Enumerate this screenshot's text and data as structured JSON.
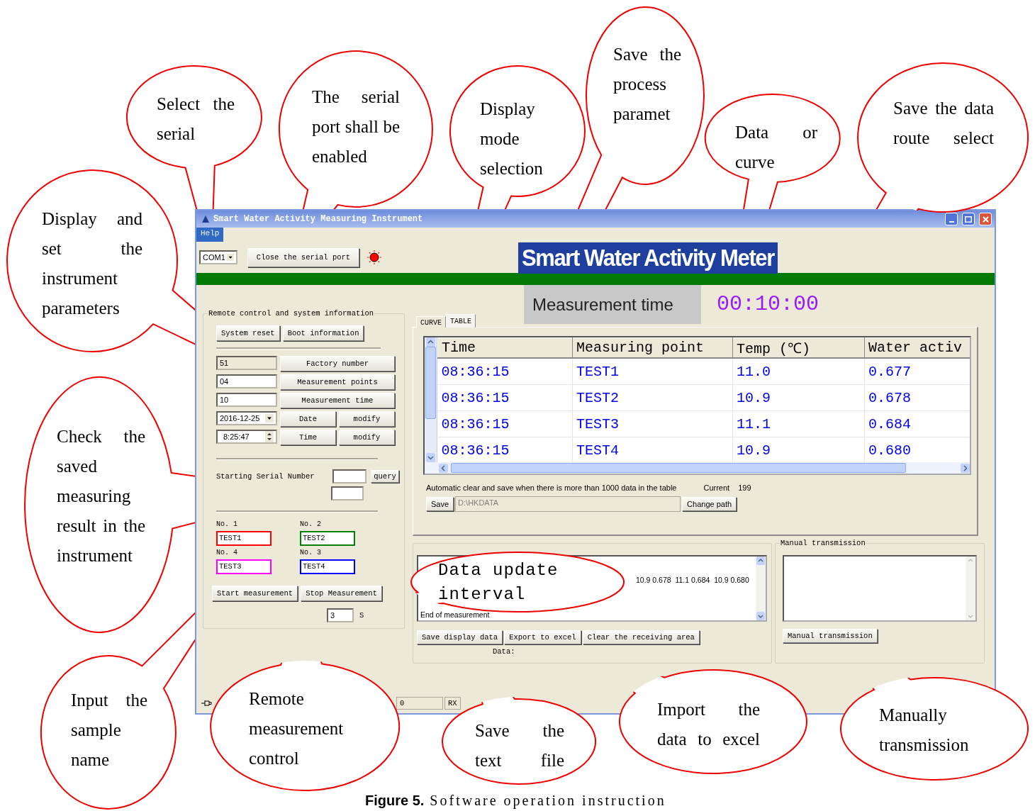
{
  "window": {
    "title": "Smart Water Activity Measuring Instrument",
    "menu": [
      {
        "label": "Help",
        "selected": true
      }
    ]
  },
  "toolbar": {
    "port": "COM1",
    "port_button": "Close the serial port",
    "port_open": true
  },
  "banner": {
    "title": "Smart Water Activity Meter",
    "time_label": "Measurement time",
    "time": "00:10:00"
  },
  "remote_panel": {
    "title": "Remote control and system information",
    "buttons": [
      "System reset",
      "Boot information"
    ],
    "params": [
      {
        "kind": "readonly",
        "value": "51",
        "button": "Factory number"
      },
      {
        "kind": "field",
        "value": "04",
        "button": "Measurement points"
      },
      {
        "kind": "field",
        "value": "10",
        "button": "Measurement time"
      },
      {
        "kind": "date",
        "value": "2016-12-25",
        "button": "Date",
        "action": "modify"
      },
      {
        "kind": "time",
        "value": "8:25:47",
        "button": "Time",
        "action": "modify"
      }
    ],
    "serial_label": "Starting Serial Number",
    "query_button": "query",
    "samples": [
      {
        "label": "No. 1",
        "name": "TEST1",
        "color": "#ff0000"
      },
      {
        "label": "No. 2",
        "name": "TEST2",
        "color": "#008000"
      },
      {
        "label": "No. 4",
        "name": "TEST3",
        "color": "#ff00ff"
      },
      {
        "label": "No. 3",
        "name": "TEST4",
        "color": "#0000ff"
      }
    ],
    "start_button": "Start measurement",
    "stop_button": "Stop Measurement",
    "interval": "3",
    "interval_unit": "S"
  },
  "tabs": [
    {
      "label": "CURVE",
      "selected": false
    },
    {
      "label": "TABLE",
      "selected": true
    }
  ],
  "table": {
    "columns": [
      "Time",
      "Measuring point",
      "Temp (℃)",
      "Water activ"
    ],
    "rows": [
      [
        "08:36:15",
        "TEST1",
        "11.0",
        "0.677"
      ],
      [
        "08:36:15",
        "TEST2",
        "10.9",
        "0.678"
      ],
      [
        "08:36:15",
        "TEST3",
        "11.1",
        "0.684"
      ],
      [
        "08:36:15",
        "TEST4",
        "10.9",
        "0.680"
      ]
    ]
  },
  "auto_note": "Automatic clear and save when there is more than 1000 data in the table",
  "current_label": "Current",
  "current": "199",
  "save_button": "Save",
  "path": {
    "value": "D:\\HKDATA",
    "disabled": true
  },
  "change_path_button": "Change path",
  "receive": {
    "lines": [
      "10.9 0.678  11.1 0.684  10.9 0.680",
      "End of measurement"
    ],
    "buttons": [
      "Save display data",
      "Export to excel",
      "Clear the receiving area"
    ],
    "data_label": "Data:"
  },
  "manual": {
    "title": "Manual transmission",
    "button": "Manual transmission"
  },
  "status_bar": [
    "0",
    "RX"
  ],
  "callouts": [
    {
      "text": "Select the serial"
    },
    {
      "text": "The serial port shall be enabled"
    },
    {
      "text": "Display mode selection"
    },
    {
      "text": "Save the process paramet"
    },
    {
      "text": "Data or curve"
    },
    {
      "text": "Save the data route select"
    },
    {
      "text": "Display and set the instrument parameters"
    },
    {
      "text": "Check the saved measuring result in the instrument"
    },
    {
      "text": "Data update interval"
    },
    {
      "text": "Input the sample name"
    },
    {
      "text": "Remote measurement control"
    },
    {
      "text": "Save the text file"
    },
    {
      "text": "Import the data to excel"
    },
    {
      "text": "Manually transmission"
    }
  ],
  "caption": {
    "label": "Figure 5.",
    "text": "Software operation instruction"
  }
}
